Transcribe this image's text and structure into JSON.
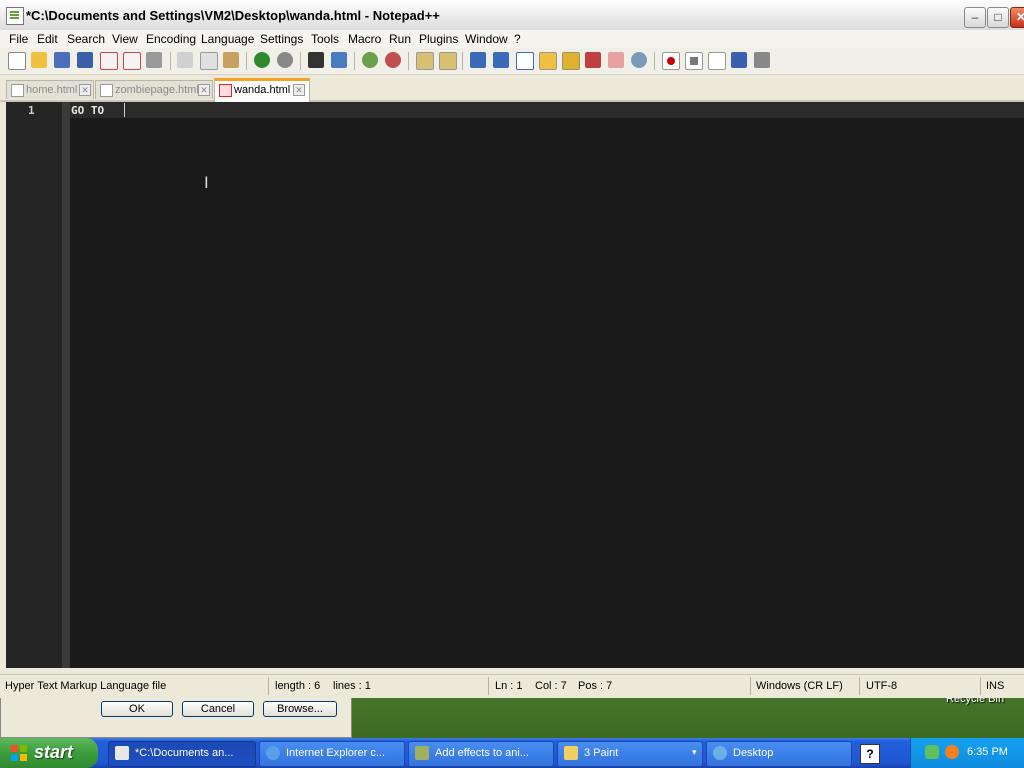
{
  "window": {
    "title": "*C:\\Documents and Settings\\VM2\\Desktop\\wanda.html - Notepad++",
    "controls": [
      "minimize",
      "maximize",
      "close"
    ]
  },
  "menu": {
    "items": [
      "File",
      "Edit",
      "Search",
      "View",
      "Encoding",
      "Language",
      "Settings",
      "Tools",
      "Macro",
      "Run",
      "Plugins",
      "Window",
      "?"
    ]
  },
  "toolbar": {
    "icons": [
      "new-file-icon",
      "open-file-icon",
      "save-icon",
      "save-all-icon",
      "close-icon",
      "close-all-icon",
      "print-icon",
      "cut-icon",
      "copy-icon",
      "paste-icon",
      "undo-icon",
      "redo-icon",
      "find-icon",
      "replace-icon",
      "zoom-in-icon",
      "zoom-out-icon",
      "sync-vertical-icon",
      "sync-horizontal-icon",
      "word-wrap-icon",
      "show-all-chars-icon",
      "indent-guide-icon",
      "user-language-icon",
      "doc-map-icon",
      "function-list-icon",
      "folder-workspace-icon",
      "monitor-icon",
      "record-macro-icon",
      "stop-macro-icon",
      "play-macro-icon",
      "run-macro-multiple-icon",
      "save-macro-icon"
    ]
  },
  "tabs": [
    {
      "label": "home.html",
      "active": false
    },
    {
      "label": "zombiepage.html",
      "active": false
    },
    {
      "label": "wanda.html",
      "active": true
    }
  ],
  "editor": {
    "lines": [
      {
        "number": "1",
        "text": "GO TO "
      }
    ]
  },
  "status": {
    "file_type": "Hyper Text Markup Language file",
    "length": "length : 6",
    "lines": "lines : 1",
    "ln": "Ln : 1",
    "col": "Col : 7",
    "pos": "Pos : 7",
    "eol": "Windows (CR LF)",
    "encoding": "UTF-8",
    "mode": "INS"
  },
  "background_dialog": {
    "ok": "OK",
    "cancel": "Cancel",
    "browse": "Browse..."
  },
  "desktop": {
    "recycle_bin": "Recycle Bin"
  },
  "taskbar": {
    "start": "start",
    "tasks": [
      {
        "label": "*C:\\Documents an...",
        "active": true
      },
      {
        "label": "Internet Explorer c...",
        "active": false
      },
      {
        "label": "Add effects to ani...",
        "active": false
      },
      {
        "label": "3 Paint",
        "active": false
      },
      {
        "label": "Desktop",
        "active": false
      }
    ],
    "clock": "6:35 PM"
  }
}
